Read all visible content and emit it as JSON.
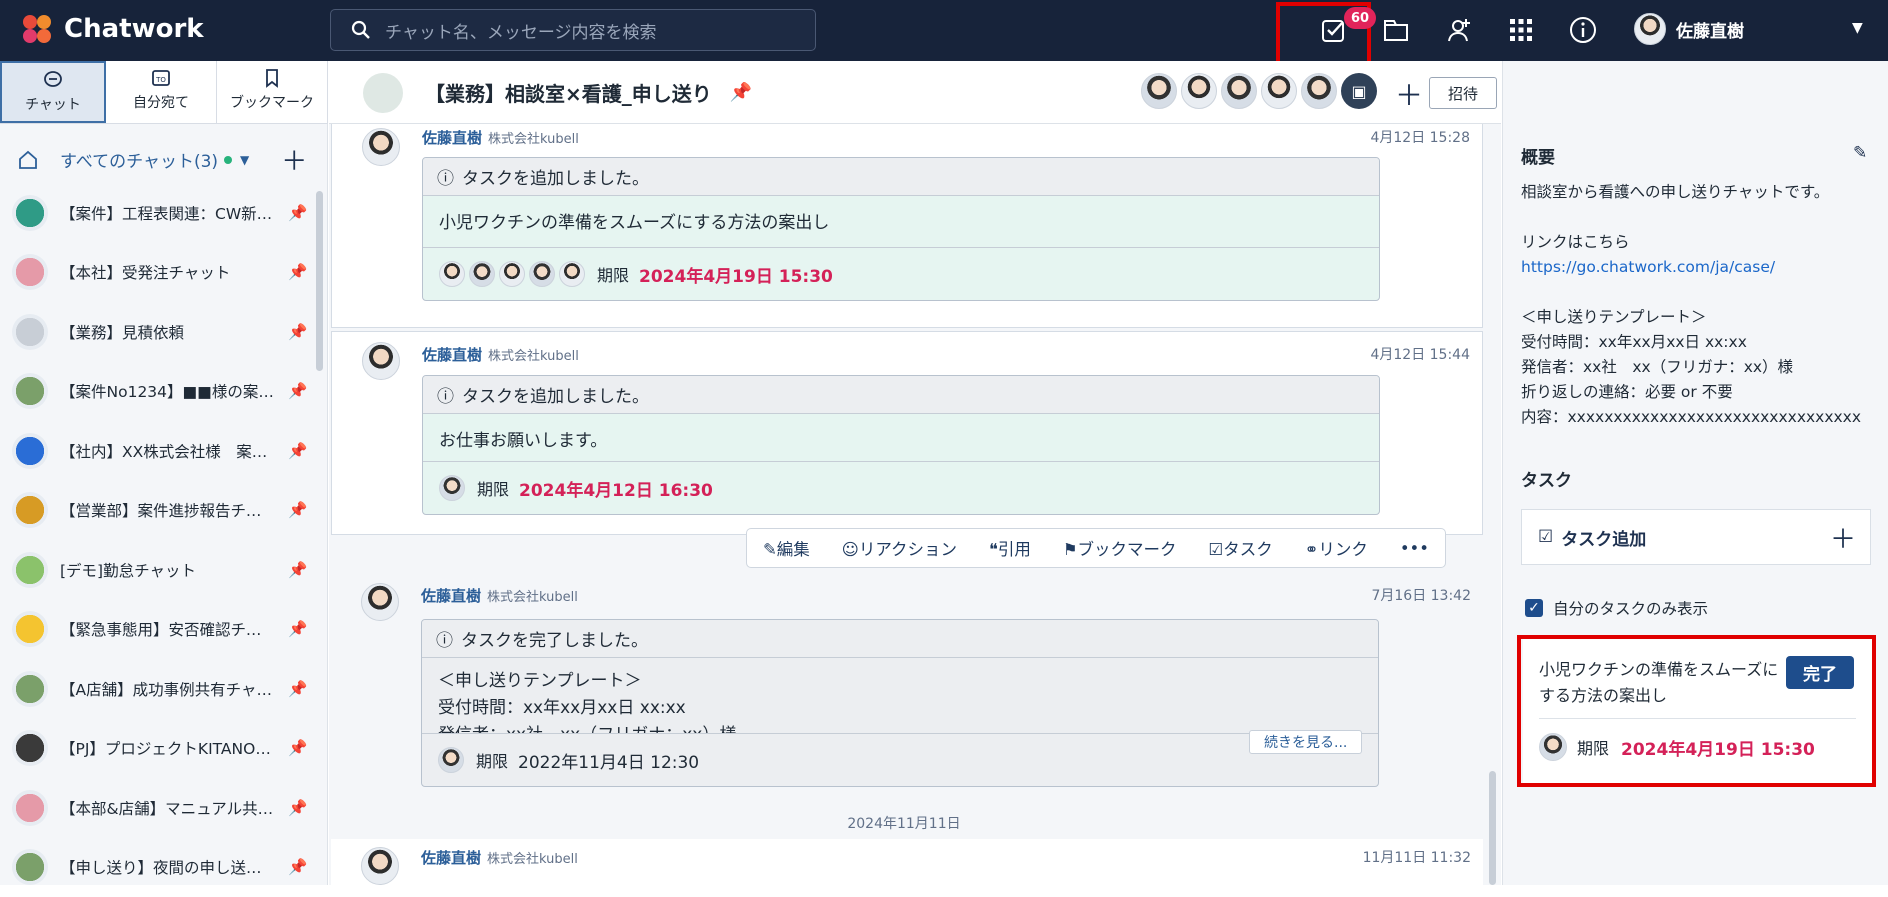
{
  "app": {
    "name": "Chatwork",
    "search_placeholder": "チャット名、メッセージ内容を検索",
    "task_badge": "60",
    "user_name": "佐藤直樹"
  },
  "left": {
    "tabs": [
      {
        "label": "チャット"
      },
      {
        "label": "自分宛て"
      },
      {
        "label": "ブックマーク"
      }
    ],
    "all_chats": "すべてのチャット(3)",
    "rooms": [
      {
        "name": "【案件】工程表関連：CW新築…",
        "color": "#2f9b86"
      },
      {
        "name": "【本社】受発注チャット",
        "color": "#e59aa8"
      },
      {
        "name": "【業務】見積依頼",
        "color": "#c8ced6"
      },
      {
        "name": "【案件No1234】■■様の案件…",
        "color": "#7ba06a"
      },
      {
        "name": "【社内】XX株式会社様　案件…",
        "color": "#2a6dd6"
      },
      {
        "name": "【営業部】案件進捗報告チャ…",
        "color": "#d79b24"
      },
      {
        "name": "[デモ]勤怠チャット",
        "color": "#8bc26b"
      },
      {
        "name": "【緊急事態用】安否確認チャ…",
        "color": "#f4c430"
      },
      {
        "name": "【A店舗】成功事例共有チャット",
        "color": "#7ba06a"
      },
      {
        "name": "【PJ】プロジェクトKITANOチ…",
        "color": "#3a3a3a"
      },
      {
        "name": "【本部&店舗】マニュアル共有…",
        "color": "#e59aa8"
      },
      {
        "name": "【申し送り】夜間の申し送りチ…",
        "color": "#7ba06a"
      }
    ]
  },
  "room": {
    "title": "【業務】相談室×看護_申し送り",
    "invite": "招待"
  },
  "messages": [
    {
      "author": "佐藤直樹",
      "company": "株式会社kubell",
      "time": "4月12日 15:28",
      "task_header": "タスクを追加しました。",
      "body": "小児ワクチンの準備をスムーズにする方法の案出し",
      "due_label": "期限",
      "due": "2024年4月19日 15:30"
    },
    {
      "author": "佐藤直樹",
      "company": "株式会社kubell",
      "time": "4月12日 15:44",
      "task_header": "タスクを追加しました。",
      "body": "お仕事お願いします。",
      "due_label": "期限",
      "due": "2024年4月12日 16:30"
    },
    {
      "author": "佐藤直樹",
      "company": "株式会社kubell",
      "time": "7月16日 13:42",
      "task_header": "タスクを完了しました。",
      "body_lines": [
        "＜申し送りテンプレート＞",
        "受付時間：xx年xx月xx日 xx:xx",
        "発信者：xx社　xx（フリガナ：xx）様"
      ],
      "due_label": "期限",
      "due": "2022年11月4日 12:30",
      "more": "続きを見る..."
    },
    {
      "author": "佐藤直樹",
      "company": "株式会社kubell",
      "time": "11月11日 11:32"
    }
  ],
  "date_divider": "2024年11月11日",
  "actions": [
    "編集",
    "リアクション",
    "引用",
    "ブックマーク",
    "タスク",
    "リンク"
  ],
  "right": {
    "overview_title": "概要",
    "overview_lines": [
      "相談室から看護への申し送りチャットです。",
      "",
      "リンクはこちら",
      "https://go.chatwork.com/ja/case/",
      "",
      "＜申し送りテンプレート＞",
      "受付時間：xx年xx月xx日 xx:xx",
      "発信者：xx社　xx（フリガナ：xx）様",
      "折り返しの連絡：必要 or 不要",
      "内容：xxxxxxxxxxxxxxxxxxxxxxxxxxxxxxxx"
    ],
    "task_title": "タスク",
    "add_task": "タスク追加",
    "only_mine": "自分のタスクのみ表示",
    "task_card": {
      "text": "小児ワクチンの準備をスムーズにする方法の案出し",
      "done": "完了",
      "due_label": "期限",
      "due": "2024年4月19日 15:30"
    }
  },
  "colors": {
    "topbar": "#17233a",
    "accent": "#1e4d8c",
    "due": "#d42158",
    "highlight": "#e00000"
  }
}
